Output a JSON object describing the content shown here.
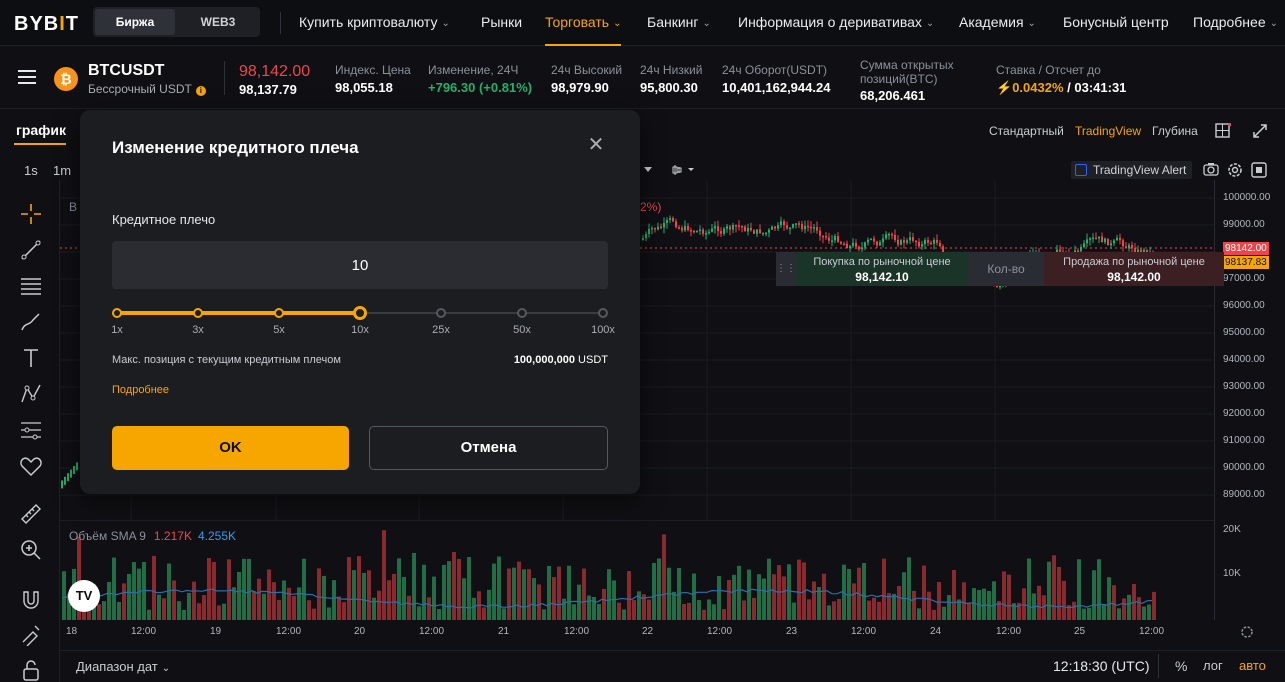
{
  "brand": {
    "logo_text": "BYB",
    "logo_accent": "I",
    "logo_tail": "T",
    "accent_color": "#f7a600"
  },
  "segment": {
    "exchange": "Биржа",
    "web3": "WEB3"
  },
  "nav": {
    "items": [
      {
        "label": "Купить криптовалюту",
        "dropdown": true
      },
      {
        "label": "Рынки",
        "dropdown": false
      },
      {
        "label": "Торговать",
        "dropdown": true,
        "active": true
      },
      {
        "label": "Банкинг",
        "dropdown": true
      },
      {
        "label": "Информация о деривативах",
        "dropdown": true
      },
      {
        "label": "Академия",
        "dropdown": true
      },
      {
        "label": "Бонусный центр",
        "dropdown": false
      },
      {
        "label": "Подробнее",
        "dropdown": true
      }
    ]
  },
  "ticker": {
    "coin_glyph": "₿",
    "symbol": "BTCUSDT",
    "contract": "Бессрочный USDT",
    "last_price": "98,142.00",
    "mark_price": "98,137.79",
    "stats": [
      {
        "label": "Индекс. Цена",
        "value": "98,055.18",
        "color": ""
      },
      {
        "label": "Изменение, 24Ч",
        "value": "+796.30 (+0.81%)",
        "color": "green"
      },
      {
        "label": "24ч Высокий",
        "value": "98,979.90",
        "color": ""
      },
      {
        "label": "24ч Низкий",
        "value": "95,800.30",
        "color": ""
      },
      {
        "label": "24ч Оборот(USDT)",
        "value": "10,401,162,944.24",
        "color": ""
      }
    ],
    "open_interest_label_1": "Сумма открытых",
    "open_interest_label_2": "позиций(BTC)",
    "open_interest": "68,206.461",
    "funding_label": "Ставка / Отсчет до",
    "funding_rate": "0.0432%",
    "funding_sep": " / ",
    "countdown": "03:41:31"
  },
  "chart_tab": "график",
  "timeframes": [
    "1s",
    "1m"
  ],
  "views": {
    "standard": "Стандартный",
    "tradingview": "TradingView",
    "depth": "Глубина"
  },
  "tv_alert": "TradingView Alert",
  "partial_legend": "2%)",
  "price_axis": [
    "100000.00",
    "99000.00",
    "97000.00",
    "96000.00",
    "95000.00",
    "94000.00",
    "93000.00",
    "92000.00",
    "91000.00",
    "90000.00",
    "89000.00"
  ],
  "price_tags": {
    "last": "98142.00",
    "mark": "98137.83"
  },
  "order_bar": {
    "buy_label": "Покупка по рыночной цене",
    "buy_price": "98,142.10",
    "qty_label": "Кол-во",
    "sell_label": "Продажа по рыночной цене",
    "sell_price": "98,142.00"
  },
  "volume": {
    "label": "Объём SMA 9",
    "v1": "1.217K",
    "v2": "4.255K",
    "axis": [
      "20K",
      "10K"
    ]
  },
  "x_axis": [
    "18",
    "12:00",
    "19",
    "12:00",
    "20",
    "12:00",
    "21",
    "12:00",
    "22",
    "12:00",
    "23",
    "12:00",
    "24",
    "12:00",
    "25",
    "12:00"
  ],
  "bottom": {
    "date_range": "Диапазон дат",
    "time": "12:18:30 (UTC)",
    "percent": "%",
    "log": "лог",
    "auto": "авто"
  },
  "tv_logo": "TV",
  "modal": {
    "title": "Изменение кредитного плеча",
    "leverage_label": "Кредитное плечо",
    "leverage_value": "10",
    "slider_marks": [
      "1x",
      "3x",
      "5x",
      "10x",
      "25x",
      "50x",
      "100x"
    ],
    "selected_index": 3,
    "max_position_label": "Макс. позиция с текущим кредитным плечом",
    "max_position_value": "100,000,000",
    "max_position_unit": "USDT",
    "more_link": "Подробнее",
    "ok": "OK",
    "cancel": "Отмена"
  }
}
